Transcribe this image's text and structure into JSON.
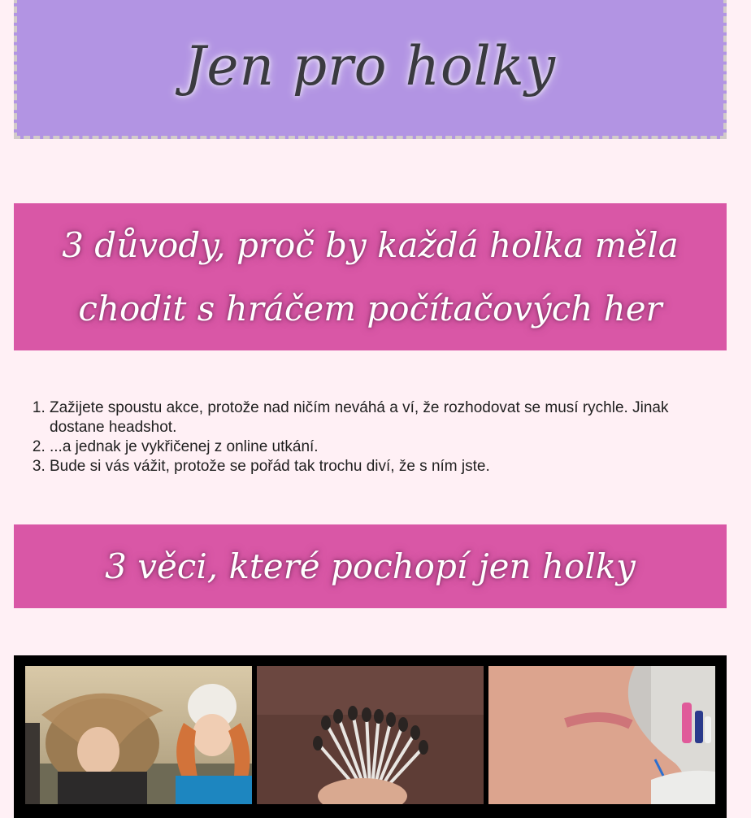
{
  "header": {
    "title": "Jen pro holky"
  },
  "section1": {
    "heading": "3 důvody, proč by každá holka měla chodit s hráčem počítačových her",
    "items": [
      "Zažijete spoustu akce, protože nad ničím neváhá a ví, že rozhodovat se musí rychle. Jinak dostane headshot.",
      "...a jednak je vykřičenej z online utkání.",
      "Bude si vás vážit, protože se pořád tak trochu diví, že s ním jste."
    ]
  },
  "section2": {
    "heading": "3 věci, které pochopí jen holky"
  },
  "colors": {
    "page_background": "#fff0f5",
    "header_background": "#b294e3",
    "banner_background": "#d957a6",
    "gallery_background": "#000000"
  },
  "gallery": {
    "photos": [
      "windy-hair-photo",
      "burnt-cotton-swabs-photo",
      "bra-strap-mark-photo"
    ]
  }
}
